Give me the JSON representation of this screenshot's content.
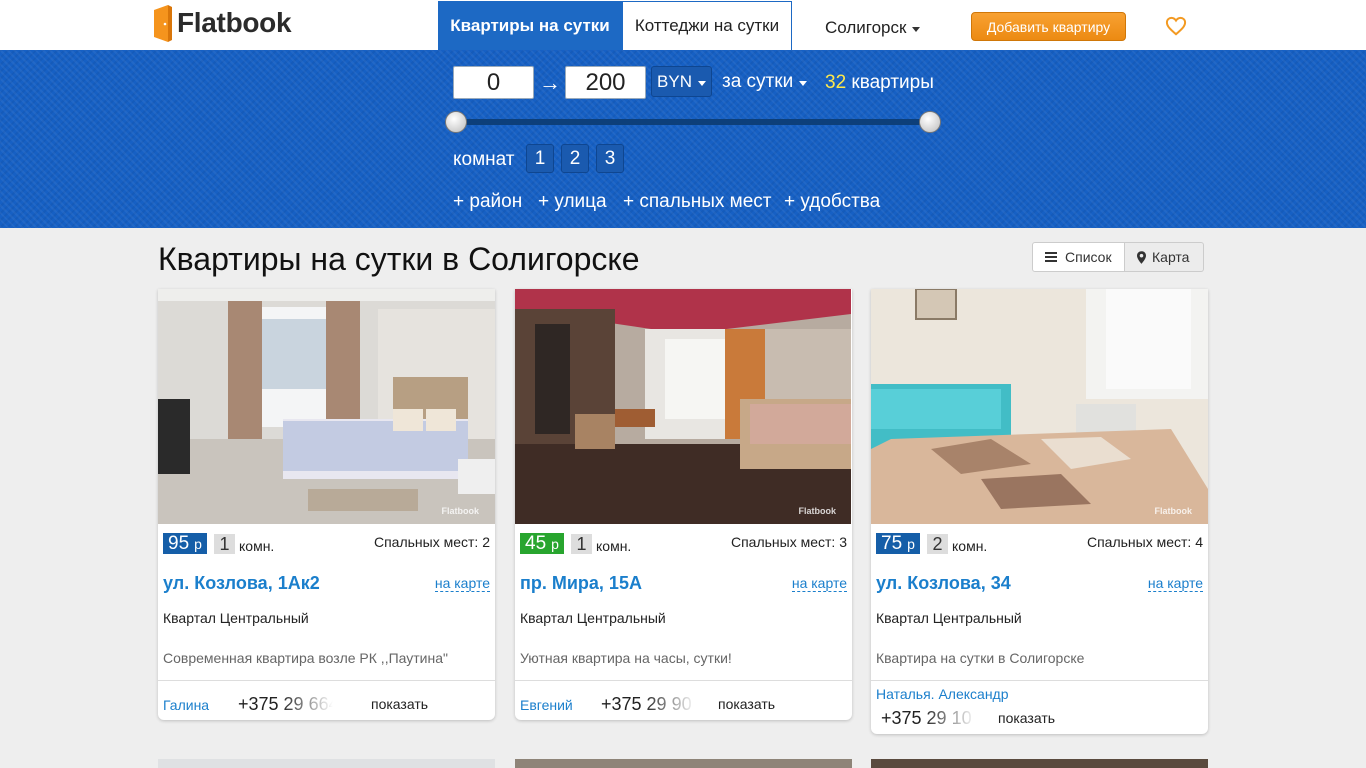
{
  "header": {
    "logo_text": "Flatbook",
    "tabs": [
      {
        "label": "Квартиры на сутки",
        "active": true
      },
      {
        "label": "Коттеджи на сутки",
        "active": false
      }
    ],
    "city": "Солигорск",
    "add_button": "Добавить квартиру",
    "accent_color": "#1d69c4",
    "add_color": "#f39a22"
  },
  "filter": {
    "price_min": "0",
    "price_max": "200",
    "arrow": "→",
    "currency": "BYN",
    "period": "за сутки",
    "count_number": "32",
    "count_label": "квартиры",
    "slider_range": [
      0,
      200
    ],
    "slider_value": [
      0,
      200
    ],
    "rooms_label": "комнат",
    "rooms": [
      "1",
      "2",
      "3"
    ],
    "extras": [
      "+ район",
      "+ улица",
      "+ спальных мест",
      "+ удобства"
    ]
  },
  "main": {
    "title": "Квартиры на сутки в Солигорске",
    "view_list": "Список",
    "view_map": "Карта"
  },
  "cards": [
    {
      "price": "95",
      "currency": "р",
      "price_color": "#155ea8",
      "rooms": "1",
      "rooms_suffix": "комн.",
      "beds": "Спальных мест: 2",
      "address": "ул. Козлова, 1Ак2",
      "on_map": "на карте",
      "district": "Квартал Центральный",
      "description": "Современная квартира возле РК ,,Паутина\"",
      "owner": "Галина",
      "phone": "+375 29 664",
      "show": "показать"
    },
    {
      "price": "45",
      "currency": "р",
      "price_color": "#28a52e",
      "rooms": "1",
      "rooms_suffix": "комн.",
      "beds": "Спальных мест: 3",
      "address": "пр. Мира, 15А",
      "on_map": "на карте",
      "district": "Квартал Центральный",
      "description": "Уютная квартира на часы, сутки!",
      "owner": "Евгений",
      "phone": "+375 29 90",
      "show": "показать"
    },
    {
      "price": "75",
      "currency": "р",
      "price_color": "#155ea8",
      "rooms": "2",
      "rooms_suffix": "комн.",
      "beds": "Спальных мест: 4",
      "address": "ул. Козлова, 34",
      "on_map": "на карте",
      "district": "Квартал Центральный",
      "description": "Квартира на сутки в Солигорске",
      "owner": "Наталья. Александр",
      "phone": "+375 29 10",
      "show": "показать"
    }
  ]
}
